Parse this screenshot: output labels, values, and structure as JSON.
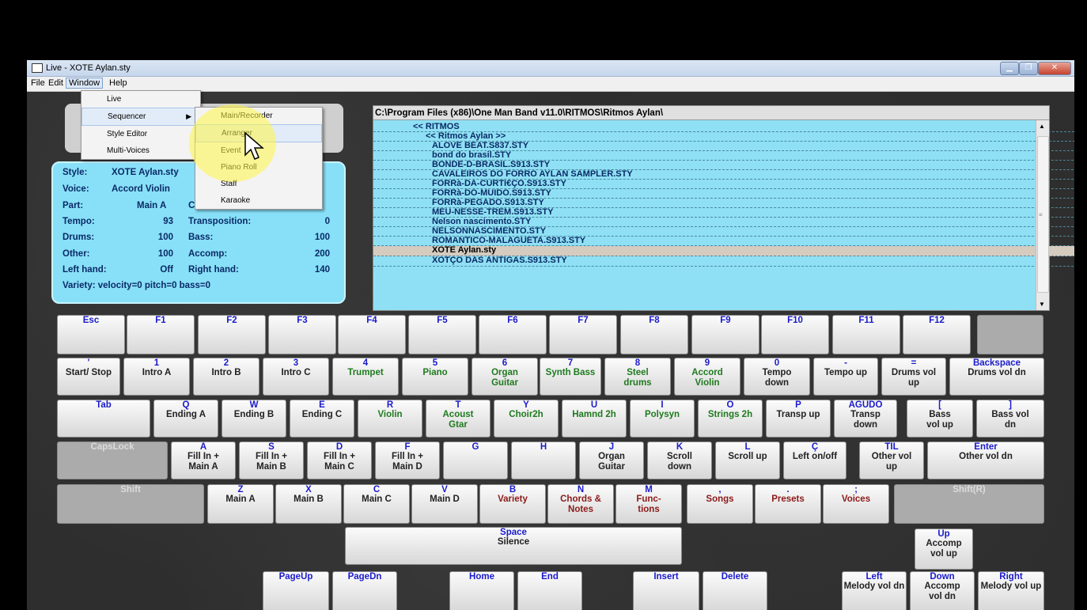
{
  "window": {
    "title": "Live - XOTE Aylan.sty"
  },
  "menubar": {
    "items": [
      "File",
      "Edit",
      "Window",
      "Help"
    ]
  },
  "window_menu": {
    "items": [
      "Live",
      "Sequencer",
      "Style Editor",
      "Multi-Voices"
    ]
  },
  "sequencer_menu": {
    "items": [
      "Main/Recorder",
      "Arranger",
      "Event",
      "Piano Roll",
      "Staff",
      "Karaoke"
    ]
  },
  "info": {
    "style_label": "Style:",
    "style_value": "XOTE Aylan.sty",
    "voice_label": "Voice:",
    "voice_value": "Accord Violin",
    "part_label": "Part:",
    "part_value": "Main A",
    "part_extra": "C",
    "tempo_label": "Tempo:",
    "tempo_value": "93",
    "transp_label": "Transposition:",
    "transp_value": "0",
    "drums_label": "Drums:",
    "drums_value": "100",
    "bass_label": "Bass:",
    "bass_value": "100",
    "other_label": "Other:",
    "other_value": "100",
    "accomp_label": "Accomp:",
    "accomp_value": "200",
    "lefthand_label": "Left hand:",
    "lefthand_value": "Off",
    "righthand_label": "Right hand:",
    "righthand_value": "140",
    "variety": "Variety: velocity=0 pitch=0 bass=0"
  },
  "list": {
    "path": "C:\\Program Files (x86)\\One Man Band v11.0\\RITMOS\\Ritmos Aylan\\",
    "items": [
      "<< RITMOS",
      "<< Ritmos Aylan >>",
      "ALOVE BEAT.S837.STY",
      "bond do brasil.STY",
      "BONDE-D-BRASIL.S913.STY",
      "CAVALEIROS DO FORRO AYLAN SAMPLER.STY",
      "FORRà-DA-CURTI€ÇO.S913.STY",
      "FORRà-DO-MUIDO.S913.STY",
      "FORRà-PEGADO.S913.STY",
      "MEU-NESSE-TREM.S913.STY",
      "Nelson nascimento.STY",
      "NELSONNASCIMENTO.STY",
      "ROMANTICO-MALAGUETA.S913.STY",
      "XOTE Aylan.sty",
      "XOTÇO DAS ANTIGAS.S913.STY"
    ],
    "selected": "XOTE Aylan.sty"
  },
  "keys": {
    "esc": {
      "top": "Esc",
      "main": ""
    },
    "f1": {
      "top": "F1",
      "main": ""
    },
    "f2": {
      "top": "F2",
      "main": ""
    },
    "f3": {
      "top": "F3",
      "main": ""
    },
    "f4": {
      "top": "F4",
      "main": ""
    },
    "f5": {
      "top": "F5",
      "main": ""
    },
    "f6": {
      "top": "F6",
      "main": ""
    },
    "f7": {
      "top": "F7",
      "main": ""
    },
    "f8": {
      "top": "F8",
      "main": ""
    },
    "f9": {
      "top": "F9",
      "main": ""
    },
    "f10": {
      "top": "F10",
      "main": ""
    },
    "f11": {
      "top": "F11",
      "main": ""
    },
    "f12": {
      "top": "F12",
      "main": ""
    },
    "tick": {
      "top": "'",
      "main": "Start/ Stop"
    },
    "k1": {
      "top": "1",
      "main": "Intro A"
    },
    "k2": {
      "top": "2",
      "main": "Intro B"
    },
    "k3": {
      "top": "3",
      "main": "Intro C"
    },
    "k4": {
      "top": "4",
      "main": "Trumpet"
    },
    "k5": {
      "top": "5",
      "main": "Piano"
    },
    "k6": {
      "top": "6",
      "main": "Organ Guitar"
    },
    "k7": {
      "top": "7",
      "main": "Synth Bass"
    },
    "k8": {
      "top": "8",
      "main": "Steel drums"
    },
    "k9": {
      "top": "9",
      "main": "Accord Violin"
    },
    "k0": {
      "top": "0",
      "main": "Tempo down"
    },
    "kminus": {
      "top": "-",
      "main": "Tempo up"
    },
    "kequal": {
      "top": "=",
      "main": "Drums vol up"
    },
    "backspace": {
      "top": "Backspace",
      "main": "Drums vol dn"
    },
    "tab": {
      "top": "Tab",
      "main": ""
    },
    "q": {
      "top": "Q",
      "main": "Ending A"
    },
    "w": {
      "top": "W",
      "main": "Ending B"
    },
    "e": {
      "top": "E",
      "main": "Ending C"
    },
    "r": {
      "top": "R",
      "main": "Violin"
    },
    "t": {
      "top": "T",
      "main": "Acoust Gtar"
    },
    "y": {
      "top": "Y",
      "main": "Choir2h"
    },
    "u": {
      "top": "U",
      "main": "Hamnd 2h"
    },
    "i": {
      "top": "I",
      "main": "Polysyn"
    },
    "o": {
      "top": "O",
      "main": "Strings 2h"
    },
    "p": {
      "top": "P",
      "main": "Transp up"
    },
    "agudo": {
      "top": "AGUDO",
      "main": "Transp down"
    },
    "lbracket": {
      "top": "[",
      "main": "Bass vol up"
    },
    "rbracket": {
      "top": "]",
      "main": "Bass vol dn"
    },
    "capslock": {
      "top": "CapsLock",
      "main": ""
    },
    "a": {
      "top": "A",
      "main": "Fill In + Main A"
    },
    "s": {
      "top": "S",
      "main": "Fill In + Main B"
    },
    "d": {
      "top": "D",
      "main": "Fill In + Main C"
    },
    "f": {
      "top": "F",
      "main": "Fill In + Main D"
    },
    "g": {
      "top": "G",
      "main": ""
    },
    "h": {
      "top": "H",
      "main": ""
    },
    "j": {
      "top": "J",
      "main": "Organ Guitar"
    },
    "k": {
      "top": "K",
      "main": "Scroll down"
    },
    "l": {
      "top": "L",
      "main": "Scroll up"
    },
    "cedil": {
      "top": "Ç",
      "main": "Left on/off"
    },
    "til": {
      "top": "TIL",
      "main": "Other vol up"
    },
    "enter": {
      "top": "Enter",
      "main": "Other vol dn"
    },
    "shift": {
      "top": "Shift",
      "main": ""
    },
    "z": {
      "top": "Z",
      "main": "Main A"
    },
    "x": {
      "top": "X",
      "main": "Main B"
    },
    "c": {
      "top": "C",
      "main": "Main C"
    },
    "v": {
      "top": "V",
      "main": "Main D"
    },
    "b": {
      "top": "B",
      "main": "Variety"
    },
    "n": {
      "top": "N",
      "main": "Chords & Notes"
    },
    "m": {
      "top": "M",
      "main": "Func- tions"
    },
    "comma": {
      "top": ",",
      "main": "Songs"
    },
    "period": {
      "top": ".",
      "main": "Presets"
    },
    "semicolon": {
      "top": ";",
      "main": "Voices"
    },
    "shiftr": {
      "top": "Shift(R)",
      "main": ""
    },
    "space": {
      "top": "Space",
      "main": "Silence"
    },
    "up": {
      "top": "Up",
      "main": "Accomp vol up"
    },
    "pageup": {
      "top": "PageUp",
      "main": ""
    },
    "pagedn": {
      "top": "PageDn",
      "main": ""
    },
    "home": {
      "top": "Home",
      "main": ""
    },
    "end": {
      "top": "End",
      "main": ""
    },
    "insert": {
      "top": "Insert",
      "main": ""
    },
    "delete": {
      "top": "Delete",
      "main": ""
    },
    "left": {
      "top": "Left",
      "main": "Melody vol dn"
    },
    "down": {
      "top": "Down",
      "main": "Accomp vol dn"
    },
    "right": {
      "top": "Right",
      "main": "Melody vol up"
    }
  }
}
